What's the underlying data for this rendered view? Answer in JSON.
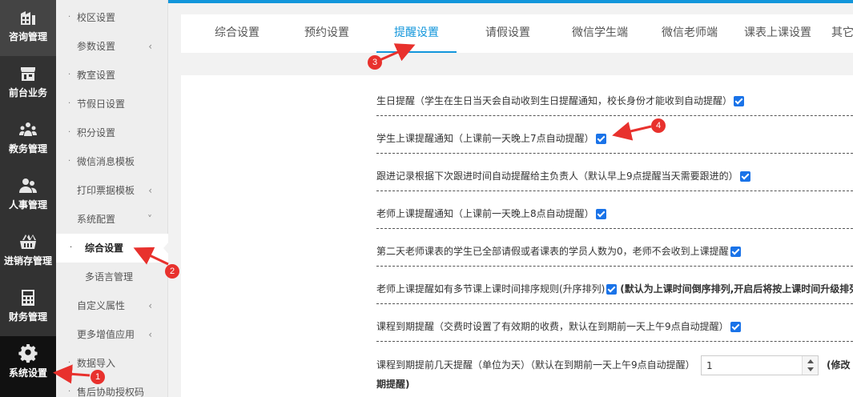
{
  "rail": [
    {
      "label": "咨询管理",
      "icon": "building-icon"
    },
    {
      "label": "前台业务",
      "icon": "store-icon"
    },
    {
      "label": "教务管理",
      "icon": "group-icon"
    },
    {
      "label": "人事管理",
      "icon": "people-icon"
    },
    {
      "label": "进销存管理",
      "icon": "basket-icon"
    },
    {
      "label": "财务管理",
      "icon": "calculator-icon"
    },
    {
      "label": "系统设置",
      "icon": "gear-icon"
    }
  ],
  "submenu": [
    {
      "label": "校区设置"
    },
    {
      "label": "参数设置",
      "chev": "‹"
    },
    {
      "label": "教室设置"
    },
    {
      "label": "节假日设置"
    },
    {
      "label": "积分设置"
    },
    {
      "label": "微信消息模板"
    },
    {
      "label": "打印票据模板",
      "chev": "‹"
    },
    {
      "label": "系统配置",
      "chev": "˅"
    },
    {
      "label": "综合设置"
    },
    {
      "label": "多语言管理"
    },
    {
      "label": "自定义属性",
      "chev": "‹"
    },
    {
      "label": "更多增值应用",
      "chev": "‹"
    },
    {
      "label": "数据导入"
    },
    {
      "label": "售后协助授权码"
    }
  ],
  "tabs": [
    "综合设置",
    "预约设置",
    "提醒设置",
    "请假设置",
    "微信学生端",
    "微信老师端",
    "课表上课设置",
    "其它"
  ],
  "active_tab": "提醒设置",
  "settings": [
    {
      "text": "生日提醒（学生在生日当天会自动收到生日提醒通知，校长身份才能收到自动提醒）",
      "checked": true
    },
    {
      "text": "学生上课提醒通知（上课前一天晚上7点自动提醒）",
      "checked": true
    },
    {
      "text": "跟进记录根据下次跟进时间自动提醒给主负责人（默认早上9点提醒当天需要跟进的）",
      "checked": true
    },
    {
      "text": "老师上课提醒通知（上课前一天晚上8点自动提醒）",
      "checked": true
    },
    {
      "text": "第二天老师课表的学生已全部请假或者课表的学员人数为0，老师不会收到上课提醒",
      "checked": true
    },
    {
      "text": "老师上课提醒如有多节课上课时间排序规则(升序排列)",
      "checked": true,
      "note": "(默认为上课时间倒序排列,开启后将按上课时间升级排列"
    },
    {
      "text": "课程到期提醒（交费时设置了有效期的收费，默认在到期前一天上午9点自动提醒）",
      "checked": true
    }
  ],
  "days_setting": {
    "label": "课程到期提前几天提醒（单位为天）（默认在到期前一天上午9点自动提醒）",
    "value": "1",
    "note": "(修改",
    "note_line2": "期提醒)"
  },
  "annotations": [
    "1",
    "2",
    "3",
    "4"
  ],
  "colors": {
    "accent": "#1296db",
    "marker": "#e8312d",
    "checkbox": "#1a73e8"
  }
}
